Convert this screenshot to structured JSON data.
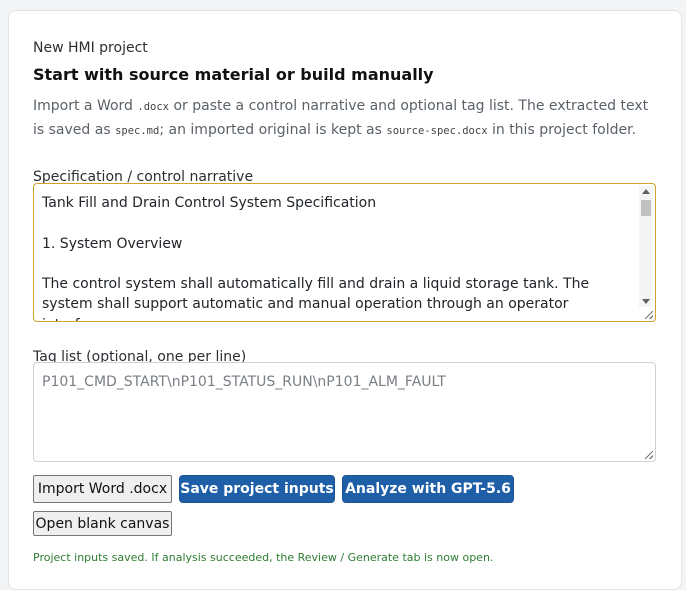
{
  "header": {
    "eyebrow": "New HMI project",
    "title": "Start with source material or build manually"
  },
  "description": {
    "part1": "Import a Word ",
    "code1": ".docx",
    "part2": " or paste a control narrative and optional tag list. The extracted text is saved as ",
    "code2": "spec.md",
    "part3": "; an imported original is kept as ",
    "code3": "source-spec.docx",
    "part4": " in this project folder."
  },
  "spec": {
    "label": "Specification / control narrative",
    "value": "Tank Fill and Drain Control System Specification\n\n1. System Overview\n\nThe control system shall automatically fill and drain a liquid storage tank. The system shall support automatic and manual operation through an operator interface."
  },
  "tags": {
    "label": "Tag list (optional, one per line)",
    "placeholder": "P101_CMD_START\\nP101_STATUS_RUN\\nP101_ALM_FAULT"
  },
  "buttons": {
    "import_docx": "Import Word .docx",
    "save_inputs": "Save project inputs",
    "analyze": "Analyze with GPT-5.6",
    "blank_canvas": "Open blank canvas"
  },
  "status": {
    "message": "Project inputs saved. If analysis succeeded, the Review / Generate tab is now open."
  },
  "colors": {
    "primary": "#1f5fa8",
    "focus_border": "#d4a02e",
    "success_text": "#2e7d32"
  }
}
